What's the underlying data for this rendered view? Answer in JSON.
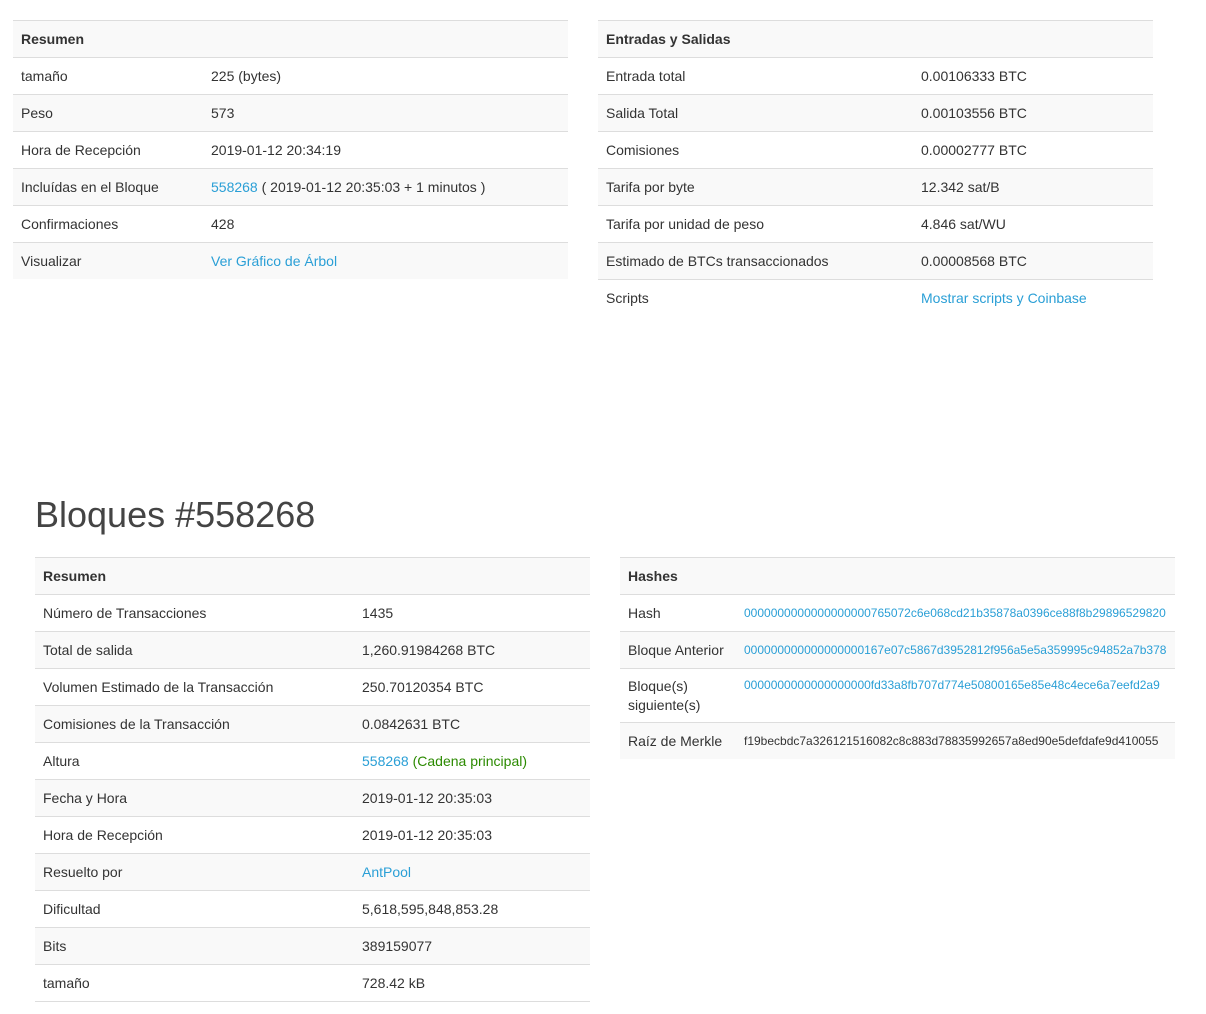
{
  "tx_summary": {
    "header": "Resumen",
    "rows": [
      {
        "label": "tamaño",
        "value": "225 (bytes)"
      },
      {
        "label": "Peso",
        "value": "573"
      },
      {
        "label": "Hora de Recepción",
        "value": "2019-01-12 20:34:19"
      },
      {
        "label": "Incluídas en el Bloque",
        "link": "558268",
        "value": " ( 2019-01-12 20:35:03 + 1 minutos )"
      },
      {
        "label": "Confirmaciones",
        "value": "428"
      },
      {
        "label": "Visualizar",
        "link": "Ver Gráfico de Árbol"
      }
    ]
  },
  "tx_io": {
    "header": "Entradas y Salidas",
    "rows": [
      {
        "label": "Entrada total",
        "value": "0.00106333 BTC"
      },
      {
        "label": "Salida Total",
        "value": "0.00103556 BTC"
      },
      {
        "label": "Comisiones",
        "value": "0.00002777 BTC"
      },
      {
        "label": "Tarifa por byte",
        "value": "12.342 sat/B"
      },
      {
        "label": "Tarifa por unidad de peso",
        "value": "4.846 sat/WU"
      },
      {
        "label": "Estimado de BTCs transaccionados",
        "value": "0.00008568 BTC"
      },
      {
        "label": "Scripts",
        "link": "Mostrar scripts y Coinbase"
      }
    ]
  },
  "block": {
    "title": "Bloques #558268",
    "summary_header": "Resumen",
    "rows": [
      {
        "label": "Número de Transacciones",
        "value": "1435"
      },
      {
        "label": "Total de salida",
        "value": "1,260.91984268 BTC"
      },
      {
        "label": "Volumen Estimado de la Transacción",
        "value": "250.70120354 BTC"
      },
      {
        "label": "Comisiones de la Transacción",
        "value": "0.0842631 BTC"
      },
      {
        "label": "Altura",
        "link": "558268",
        "extra": " (Cadena principal)"
      },
      {
        "label": "Fecha y Hora",
        "value": "2019-01-12 20:35:03"
      },
      {
        "label": "Hora de Recepción",
        "value": "2019-01-12 20:35:03"
      },
      {
        "label": "Resuelto por",
        "link": "AntPool"
      },
      {
        "label": "Dificultad",
        "value": "5,618,595,848,853.28"
      },
      {
        "label": "Bits",
        "value": "389159077"
      },
      {
        "label": "tamaño",
        "value": "728.42 kB"
      }
    ],
    "hashes_header": "Hashes",
    "hashes": [
      {
        "label": "Hash",
        "link": "0000000000000000000765072c6e068cd21b35878a0396ce88f8b29896529820"
      },
      {
        "label": "Bloque Anterior",
        "link": "000000000000000000167e07c5867d3952812f956a5e5a359995c94852a7b378"
      },
      {
        "label": "Bloque(s) siguiente(s)",
        "link": "0000000000000000000fd33a8fb707d774e50800165e85e48c4ece6a7eefd2a9"
      },
      {
        "label": "Raíz de Merkle",
        "value": "f19becbdc7a326121516082c8c883d78835992657a8ed90e5defdafe9d410055"
      }
    ]
  },
  "colors": {
    "link": "#2a9fd6",
    "green": "#2b8a00",
    "stripe": "#f9f9f9"
  }
}
